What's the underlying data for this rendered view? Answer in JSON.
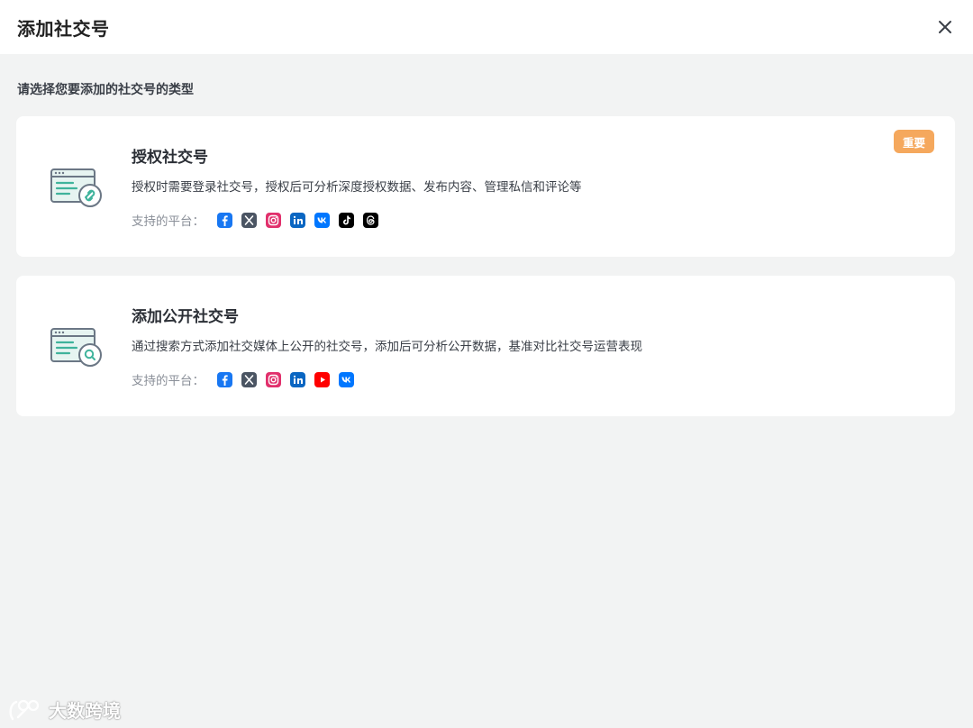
{
  "dialog": {
    "title": "添加社交号",
    "close_icon": "close-icon"
  },
  "prompt": "请选择您要添加的社交号的类型",
  "cards": [
    {
      "title": "授权社交号",
      "description": "授权时需要登录社交号，授权后可分析深度授权数据、发布内容、管理私信和评论等",
      "platforms_label": "支持的平台：",
      "badge": "重要",
      "icon": "window-link-icon",
      "platforms": [
        "facebook",
        "x",
        "instagram",
        "linkedin",
        "vk",
        "tiktok",
        "threads"
      ]
    },
    {
      "title": "添加公开社交号",
      "description": "通过搜索方式添加社交媒体上公开的社交号，添加后可分析公开数据，基准对比社交号运营表现",
      "platforms_label": "支持的平台：",
      "icon": "window-search-icon",
      "platforms": [
        "facebook",
        "x",
        "instagram",
        "linkedin",
        "youtube",
        "vk"
      ]
    }
  ],
  "watermark": "大数跨境",
  "colors": {
    "badge": "#f5a85d",
    "facebook": "#1877f2",
    "x": "#4b5563",
    "instagram": "#e1306c",
    "linkedin": "#0a66c2",
    "vk": "#0077ff",
    "tiktok": "#000000",
    "threads": "#000000",
    "youtube": "#ff0000",
    "icon_teal": "#3fb39c"
  }
}
